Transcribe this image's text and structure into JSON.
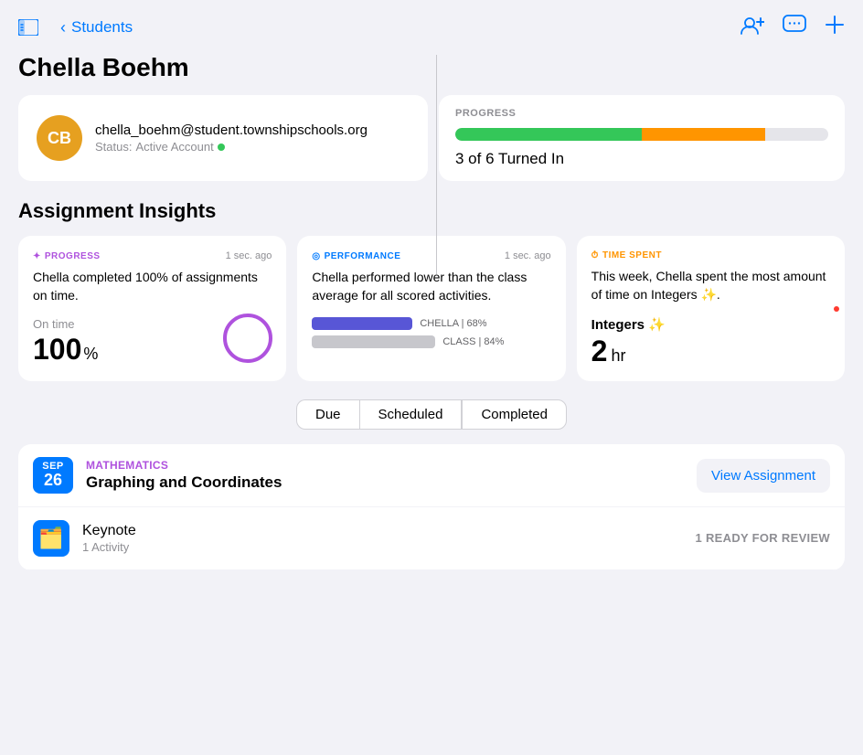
{
  "app": {
    "title": "Students"
  },
  "header": {
    "back_label": "Students",
    "student_name": "Chella Boehm",
    "avatar_initials": "CB",
    "avatar_color": "#e6a020"
  },
  "profile": {
    "email": "chella_boehm@student.townshipschools.org",
    "status_label": "Status:",
    "status_value": "Active Account"
  },
  "progress": {
    "section_label": "PROGRESS",
    "turned_in": "3 of 6 Turned In",
    "green_percent": 50,
    "orange_percent": 33
  },
  "insights": {
    "section_title": "Assignment Insights",
    "cards": [
      {
        "tag": "PROGRESS",
        "tag_icon": "↻",
        "time_ago": "1 sec. ago",
        "body": "Chella completed 100% of assignments on time.",
        "stat_label": "On time",
        "stat_value": "100",
        "stat_unit": "%"
      },
      {
        "tag": "PERFORMANCE",
        "tag_icon": "◎",
        "time_ago": "1 sec. ago",
        "body": "Chella performed lower than the class average for all scored activities.",
        "chella_label": "CHELLA | 68%",
        "chella_width": 55,
        "class_label": "CLASS | 84%",
        "class_width": 70
      },
      {
        "tag": "TIME SPENT",
        "tag_icon": "⏱",
        "time_ago": "",
        "body": "This week, Chella spent the most amount of time on Integers ✨.",
        "topic": "Integers ✨",
        "time_value": "2",
        "time_unit": "hr"
      }
    ]
  },
  "filter_tabs": [
    {
      "label": "Due",
      "active": true
    },
    {
      "label": "Scheduled",
      "active": false
    },
    {
      "label": "Completed",
      "active": false
    }
  ],
  "assignment": {
    "date_month": "SEP",
    "date_day": "26",
    "subject": "MATHEMATICS",
    "name": "Graphing and Coordinates",
    "view_button": "View Assignment",
    "activity_name": "Keynote",
    "activity_count": "1 Activity",
    "activity_status": "1 READY FOR REVIEW"
  }
}
